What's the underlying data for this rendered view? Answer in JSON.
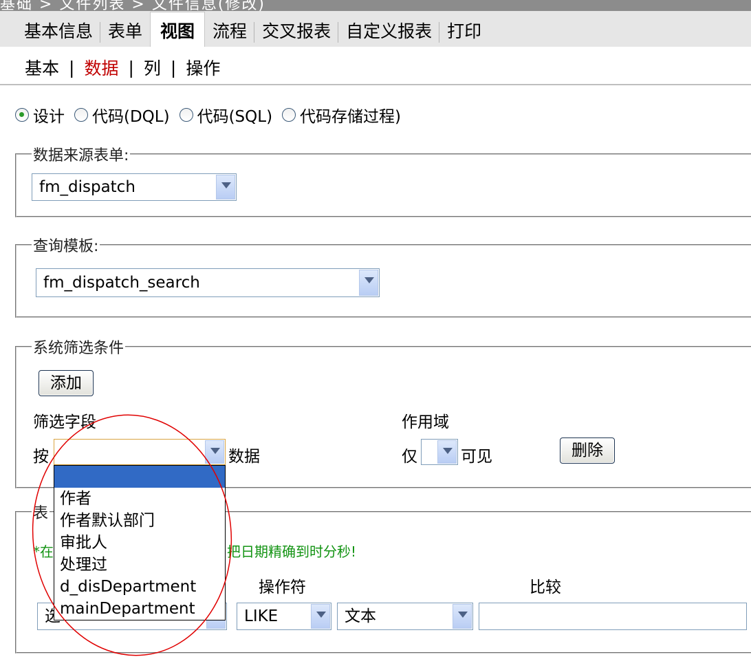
{
  "breadcrumb": "基础 > 文件列表 > 文件信息(修改)",
  "tabs": [
    {
      "label": "基本信息"
    },
    {
      "label": "表单"
    },
    {
      "label": "视图"
    },
    {
      "label": "流程"
    },
    {
      "label": "交叉报表"
    },
    {
      "label": "自定义报表"
    },
    {
      "label": "打印"
    }
  ],
  "active_tab": "视图",
  "subtabs": [
    {
      "label": "基本"
    },
    {
      "label": "数据"
    },
    {
      "label": "列"
    },
    {
      "label": "操作"
    }
  ],
  "active_subtab": "数据",
  "mode_options": [
    {
      "label": "设计",
      "checked": true
    },
    {
      "label": "代码(DQL)",
      "checked": false
    },
    {
      "label": "代码(SQL)",
      "checked": false
    },
    {
      "label": "代码存储过程)",
      "checked": false
    }
  ],
  "source_form": {
    "legend": "数据来源表单:",
    "value": "fm_dispatch"
  },
  "query_template": {
    "legend": "查询模板:",
    "value": "fm_dispatch_search"
  },
  "system_filter": {
    "legend": "系统筛选条件",
    "add_button": "添加",
    "field_header": "筛选字段",
    "scope_header": "作用域",
    "by_label": "按",
    "data_label": "数据",
    "only_label": "仅",
    "visible_label": "可见",
    "delete_button": "删除",
    "field_value": "",
    "scope_value": ""
  },
  "field_dropdown": {
    "options": [
      "",
      "作者",
      "作者默认部门",
      "审批人",
      "处理过",
      "d_disDepartment",
      "mainDepartment"
    ],
    "selected_index": 0
  },
  "form_filter": {
    "legend_partial": "表",
    "note_prefix": "*在",
    "note_suffix": "把日期精确到时分秒!",
    "operator_header": "操作符",
    "compare_header": "比较",
    "field_select_partial": "选",
    "operator_value": "LIKE",
    "type_value": "文本",
    "compare_value": ""
  },
  "colors": {
    "active_subtab": "#c00000",
    "note": "#149414",
    "annotation_circle": "#e00000",
    "dropdown_highlight": "#316ac5"
  }
}
